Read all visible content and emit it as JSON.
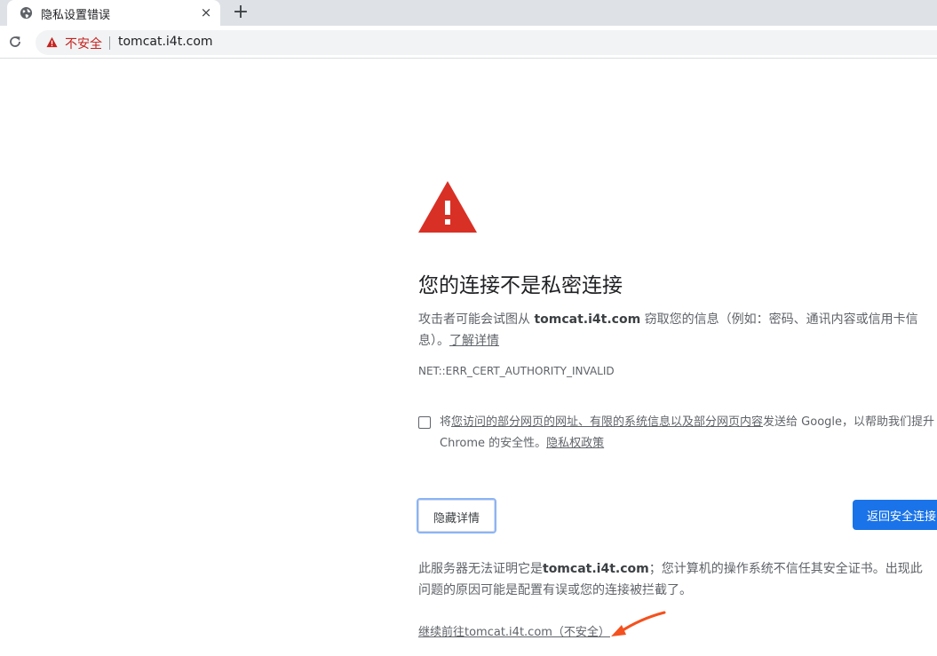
{
  "tab": {
    "title": "隐私设置错误",
    "close": "×"
  },
  "new_tab": "+",
  "omnibox": {
    "security_label": "不安全",
    "url": "tomcat.i4t.com"
  },
  "interstitial": {
    "headline": "您的连接不是私密连接",
    "desc_pre": "攻击者可能会试图从 ",
    "desc_host": "tomcat.i4t.com",
    "desc_post": " 窃取您的信息（例如：密码、通讯内容或信用卡信",
    "desc_line2": "息）。",
    "learn_more": "了解详情",
    "error_code": "NET::ERR_CERT_AUTHORITY_INVALID",
    "checkbox_pre": "将",
    "checkbox_link": "您访问的部分网页的网址、有限的系统信息以及部分网页内容",
    "checkbox_post": "发送给 Google，以帮助我们提升",
    "checkbox_line2": "Chrome 的安全性。",
    "privacy_link": "隐私权政策",
    "hide_details_button": "隐藏详情",
    "back_button": "返回安全连接",
    "detail_pre": "此服务器无法证明它是",
    "detail_host": "tomcat.i4t.com",
    "detail_post": "；您计算机的操作系统不信任其安全证书。出现此",
    "detail_line2": "问题的原因可能是配置有误或您的连接被拦截了。",
    "proceed_link": "继续前往tomcat.i4t.com（不安全）"
  },
  "colors": {
    "warning_red": "#d93025",
    "button_blue": "#1a73e8",
    "arrow_orange": "#f4511e"
  },
  "icons": [
    "globe-icon",
    "close-icon",
    "plus-icon",
    "reload-icon",
    "warning-triangle-icon",
    "large-warning-icon",
    "arrow-annotation-icon"
  ]
}
